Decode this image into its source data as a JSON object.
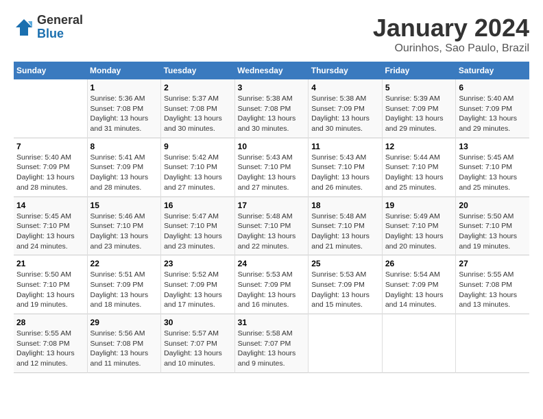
{
  "header": {
    "logo_line1": "General",
    "logo_line2": "Blue",
    "title": "January 2024",
    "subtitle": "Ourinhos, Sao Paulo, Brazil"
  },
  "days_of_week": [
    "Sunday",
    "Monday",
    "Tuesday",
    "Wednesday",
    "Thursday",
    "Friday",
    "Saturday"
  ],
  "weeks": [
    [
      {
        "day": "",
        "info": ""
      },
      {
        "day": "1",
        "info": "Sunrise: 5:36 AM\nSunset: 7:08 PM\nDaylight: 13 hours\nand 31 minutes."
      },
      {
        "day": "2",
        "info": "Sunrise: 5:37 AM\nSunset: 7:08 PM\nDaylight: 13 hours\nand 30 minutes."
      },
      {
        "day": "3",
        "info": "Sunrise: 5:38 AM\nSunset: 7:08 PM\nDaylight: 13 hours\nand 30 minutes."
      },
      {
        "day": "4",
        "info": "Sunrise: 5:38 AM\nSunset: 7:09 PM\nDaylight: 13 hours\nand 30 minutes."
      },
      {
        "day": "5",
        "info": "Sunrise: 5:39 AM\nSunset: 7:09 PM\nDaylight: 13 hours\nand 29 minutes."
      },
      {
        "day": "6",
        "info": "Sunrise: 5:40 AM\nSunset: 7:09 PM\nDaylight: 13 hours\nand 29 minutes."
      }
    ],
    [
      {
        "day": "7",
        "info": "Sunrise: 5:40 AM\nSunset: 7:09 PM\nDaylight: 13 hours\nand 28 minutes."
      },
      {
        "day": "8",
        "info": "Sunrise: 5:41 AM\nSunset: 7:09 PM\nDaylight: 13 hours\nand 28 minutes."
      },
      {
        "day": "9",
        "info": "Sunrise: 5:42 AM\nSunset: 7:10 PM\nDaylight: 13 hours\nand 27 minutes."
      },
      {
        "day": "10",
        "info": "Sunrise: 5:43 AM\nSunset: 7:10 PM\nDaylight: 13 hours\nand 27 minutes."
      },
      {
        "day": "11",
        "info": "Sunrise: 5:43 AM\nSunset: 7:10 PM\nDaylight: 13 hours\nand 26 minutes."
      },
      {
        "day": "12",
        "info": "Sunrise: 5:44 AM\nSunset: 7:10 PM\nDaylight: 13 hours\nand 25 minutes."
      },
      {
        "day": "13",
        "info": "Sunrise: 5:45 AM\nSunset: 7:10 PM\nDaylight: 13 hours\nand 25 minutes."
      }
    ],
    [
      {
        "day": "14",
        "info": "Sunrise: 5:45 AM\nSunset: 7:10 PM\nDaylight: 13 hours\nand 24 minutes."
      },
      {
        "day": "15",
        "info": "Sunrise: 5:46 AM\nSunset: 7:10 PM\nDaylight: 13 hours\nand 23 minutes."
      },
      {
        "day": "16",
        "info": "Sunrise: 5:47 AM\nSunset: 7:10 PM\nDaylight: 13 hours\nand 23 minutes."
      },
      {
        "day": "17",
        "info": "Sunrise: 5:48 AM\nSunset: 7:10 PM\nDaylight: 13 hours\nand 22 minutes."
      },
      {
        "day": "18",
        "info": "Sunrise: 5:48 AM\nSunset: 7:10 PM\nDaylight: 13 hours\nand 21 minutes."
      },
      {
        "day": "19",
        "info": "Sunrise: 5:49 AM\nSunset: 7:10 PM\nDaylight: 13 hours\nand 20 minutes."
      },
      {
        "day": "20",
        "info": "Sunrise: 5:50 AM\nSunset: 7:10 PM\nDaylight: 13 hours\nand 19 minutes."
      }
    ],
    [
      {
        "day": "21",
        "info": "Sunrise: 5:50 AM\nSunset: 7:10 PM\nDaylight: 13 hours\nand 19 minutes."
      },
      {
        "day": "22",
        "info": "Sunrise: 5:51 AM\nSunset: 7:09 PM\nDaylight: 13 hours\nand 18 minutes."
      },
      {
        "day": "23",
        "info": "Sunrise: 5:52 AM\nSunset: 7:09 PM\nDaylight: 13 hours\nand 17 minutes."
      },
      {
        "day": "24",
        "info": "Sunrise: 5:53 AM\nSunset: 7:09 PM\nDaylight: 13 hours\nand 16 minutes."
      },
      {
        "day": "25",
        "info": "Sunrise: 5:53 AM\nSunset: 7:09 PM\nDaylight: 13 hours\nand 15 minutes."
      },
      {
        "day": "26",
        "info": "Sunrise: 5:54 AM\nSunset: 7:09 PM\nDaylight: 13 hours\nand 14 minutes."
      },
      {
        "day": "27",
        "info": "Sunrise: 5:55 AM\nSunset: 7:08 PM\nDaylight: 13 hours\nand 13 minutes."
      }
    ],
    [
      {
        "day": "28",
        "info": "Sunrise: 5:55 AM\nSunset: 7:08 PM\nDaylight: 13 hours\nand 12 minutes."
      },
      {
        "day": "29",
        "info": "Sunrise: 5:56 AM\nSunset: 7:08 PM\nDaylight: 13 hours\nand 11 minutes."
      },
      {
        "day": "30",
        "info": "Sunrise: 5:57 AM\nSunset: 7:07 PM\nDaylight: 13 hours\nand 10 minutes."
      },
      {
        "day": "31",
        "info": "Sunrise: 5:58 AM\nSunset: 7:07 PM\nDaylight: 13 hours\nand 9 minutes."
      },
      {
        "day": "",
        "info": ""
      },
      {
        "day": "",
        "info": ""
      },
      {
        "day": "",
        "info": ""
      }
    ]
  ]
}
